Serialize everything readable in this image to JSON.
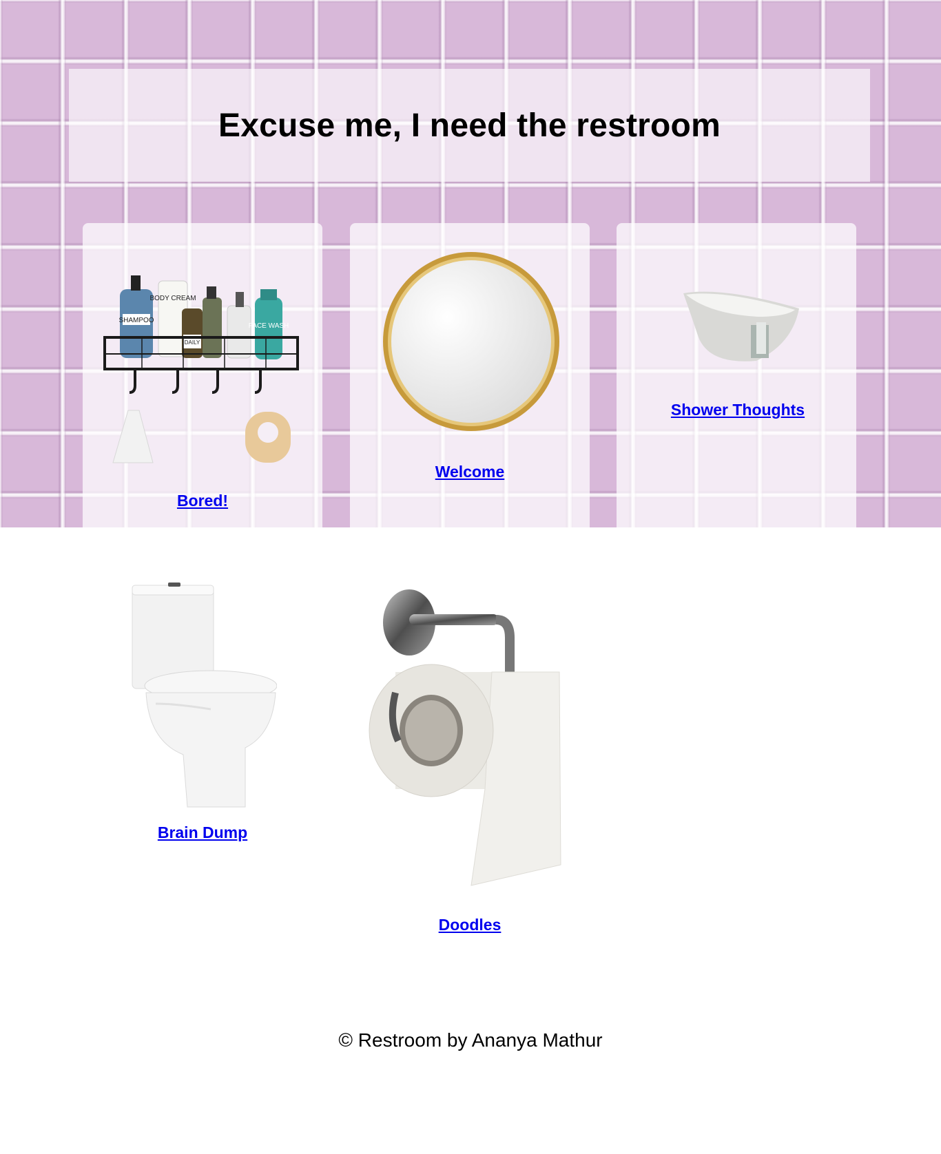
{
  "header": {
    "title": "Excuse me, I need the restroom"
  },
  "rooms": [
    {
      "label": "Bored!",
      "illustration": "shower-caddy",
      "shelf_labels": [
        "SHAMPOO",
        "BODY CREAM",
        "DAILY",
        "FACE WASH"
      ]
    },
    {
      "label": "Welcome",
      "illustration": "round-mirror"
    },
    {
      "label": "Shower Thoughts",
      "illustration": "bathtub"
    },
    {
      "label": "Brain Dump",
      "illustration": "toilet"
    },
    {
      "label": "Doodles",
      "illustration": "toilet-paper-roll"
    }
  ],
  "footer": {
    "text": "© Restroom by Ananya Mathur"
  },
  "colors": {
    "tile": "#d8b8d9",
    "link": "#0000ee",
    "text": "#000000"
  }
}
